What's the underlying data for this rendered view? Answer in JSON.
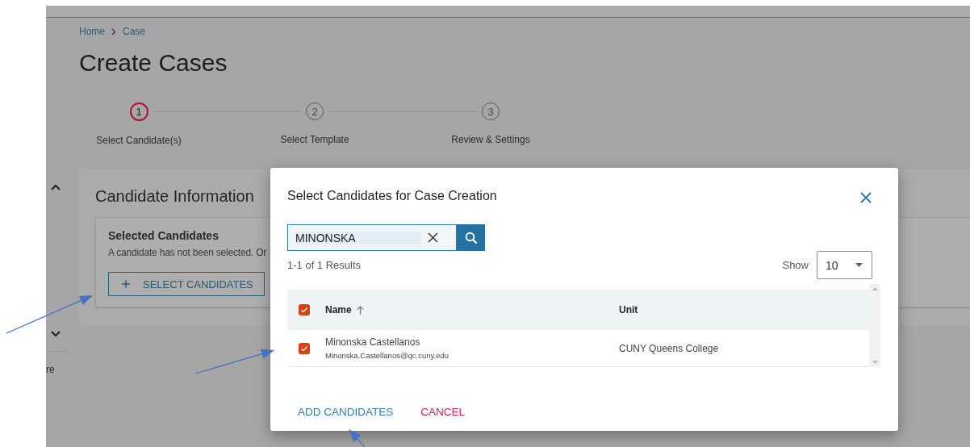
{
  "sidebar": {
    "label": "re"
  },
  "breadcrumb": [
    "Home",
    "Case"
  ],
  "title": "Create Cases",
  "steps": [
    {
      "number": "1",
      "label": "Select Candidate(s)",
      "selected": true
    },
    {
      "number": "2",
      "label": "Select Template",
      "selected": false
    },
    {
      "number": "3",
      "label": "Review & Settings",
      "selected": false
    }
  ],
  "candidate_information": {
    "heading": "Candidate Information",
    "card": {
      "title": "Selected Candidates",
      "message": "A candidate has not been selected. Or",
      "button": "SELECT CANDIDATES"
    }
  },
  "dialog": {
    "title": "Select Candidates for Case Creation",
    "search": {
      "value": "MINONSKA"
    },
    "results": "1-1 of 1 Results",
    "show": {
      "label": "Show",
      "value": "10"
    },
    "table": {
      "all_checked": true,
      "columns": [
        {
          "label": "Name",
          "sorted": true
        },
        {
          "label": "Unit",
          "sorted": false
        }
      ],
      "rows": [
        {
          "name": "Minonska Castellanos",
          "email": "Minonska.Castellanos@qc.cuny.edu",
          "unit": "CUNY Queens College",
          "checked": true
        }
      ]
    },
    "buttons": [
      {
        "label": "ADD CANDIDATES",
        "kind": "primary"
      },
      {
        "label": "CANCEL",
        "kind": "danger"
      }
    ]
  }
}
